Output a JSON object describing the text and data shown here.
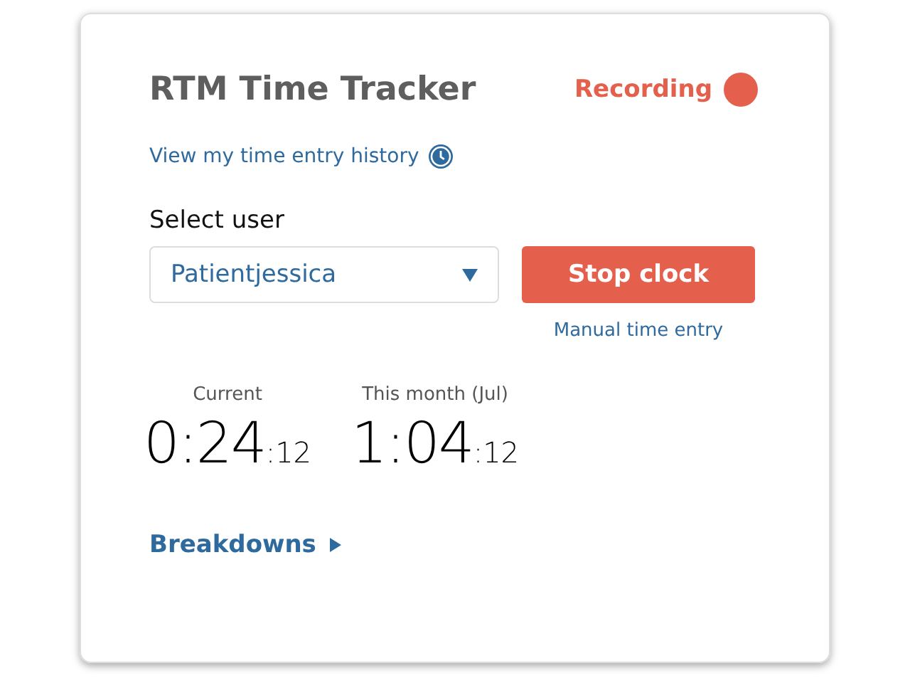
{
  "title": "RTM Time Tracker",
  "status": {
    "label": "Recording",
    "recording": true
  },
  "history_link": "View my time entry history",
  "user_select": {
    "label": "Select user",
    "value": "Patientjessica"
  },
  "stop_button": "Stop clock",
  "manual_link": "Manual time entry",
  "timers": [
    {
      "label": "Current",
      "main": "0:24",
      "seconds": ":12"
    },
    {
      "label": "This month (Jul)",
      "main": "1:04",
      "seconds": ":12"
    }
  ],
  "breakdowns": {
    "label": "Breakdowns",
    "expanded": false
  }
}
